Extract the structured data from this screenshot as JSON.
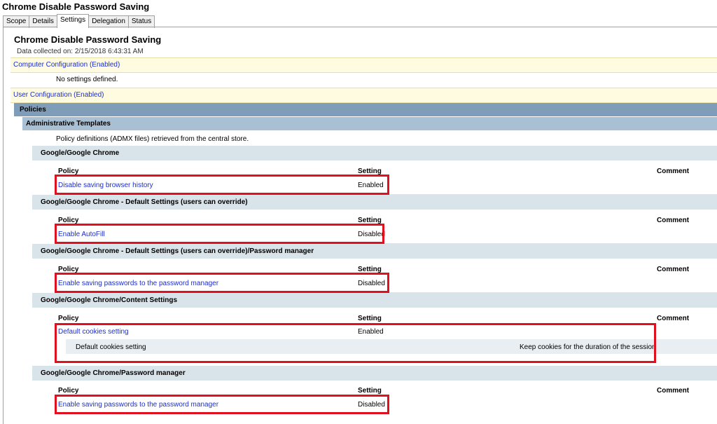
{
  "window": {
    "title": "Chrome Disable Password Saving"
  },
  "tabs": [
    "Scope",
    "Details",
    "Settings",
    "Delegation",
    "Status"
  ],
  "active_tab": "Settings",
  "report": {
    "title": "Chrome Disable Password Saving",
    "collected": "Data collected on: 2/15/2018 6:43:31 AM"
  },
  "computer_config": {
    "label": "Computer Configuration (Enabled)",
    "note": "No settings defined."
  },
  "user_config": {
    "label": "User Configuration (Enabled)"
  },
  "policies": {
    "label": "Policies"
  },
  "admin_templates": {
    "label": "Administrative Templates",
    "note": "Policy definitions (ADMX files) retrieved from the central store."
  },
  "columns": {
    "policy": "Policy",
    "setting": "Setting",
    "comment": "Comment"
  },
  "groups": [
    {
      "name": "Google/Google Chrome",
      "policy": "Disable saving browser history",
      "setting": "Enabled"
    },
    {
      "name": "Google/Google Chrome - Default Settings (users can override)",
      "policy": "Enable AutoFill",
      "setting": "Disabled"
    },
    {
      "name": "Google/Google Chrome - Default Settings (users can override)/Password manager",
      "policy": "Enable saving passwords to the password manager",
      "setting": "Disabled"
    },
    {
      "name": "Google/Google Chrome/Content Settings",
      "policy": "Default cookies setting",
      "setting": "Enabled",
      "sub_label": "Default cookies setting",
      "sub_value": "Keep cookies for the duration of the session"
    },
    {
      "name": "Google/Google Chrome/Password manager",
      "policy": "Enable saving passwords to the password manager",
      "setting": "Disabled"
    }
  ],
  "colors": {
    "highlight": "#e0101f",
    "link": "#1c2ecc",
    "config_bar": "#fefbe0",
    "policies_bar": "#7f9db9"
  }
}
